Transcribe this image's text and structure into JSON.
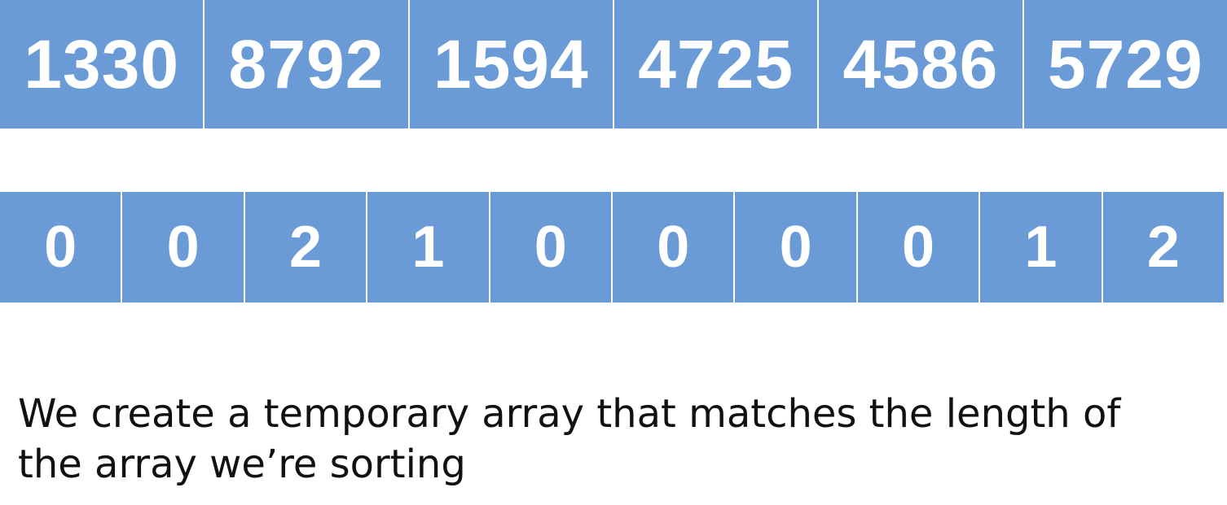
{
  "main_array": {
    "values": [
      "1330",
      "8792",
      "1594",
      "4725",
      "4586",
      "5729"
    ]
  },
  "count_array": {
    "values": [
      "0",
      "0",
      "2",
      "1",
      "0",
      "0",
      "0",
      "0",
      "1",
      "2"
    ]
  },
  "caption": {
    "text": "We create a temporary array that matches the length of the array we’re sorting"
  },
  "colors": {
    "cell_fill": "#6a9bd6",
    "cell_text": "#ffffff",
    "caption_text": "#111111"
  }
}
